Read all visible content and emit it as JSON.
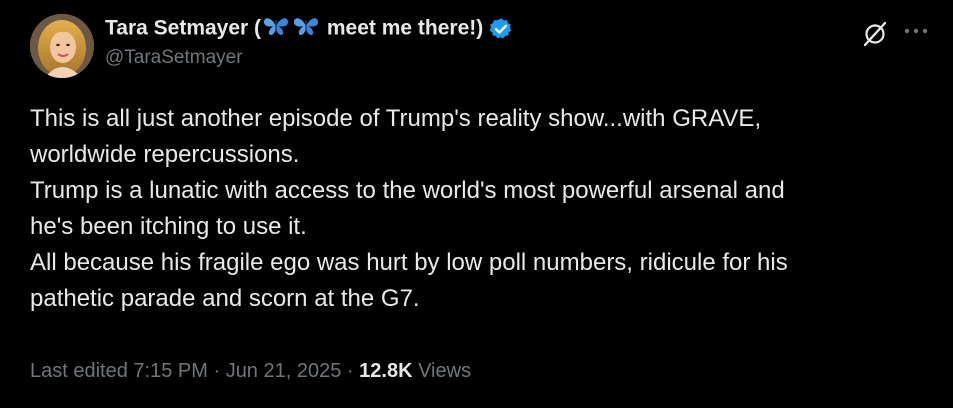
{
  "author": {
    "name_prefix": "Tara Setmayer (",
    "name_suffix": " meet me there!)",
    "handle": "@TaraSetmayer",
    "avatar_icon": "profile-photo",
    "verified_icon": "verified-badge",
    "emoji_icon": "butterfly-icon"
  },
  "actions": {
    "grok_icon": "grok-icon",
    "more_icon": "more-options-icon"
  },
  "tweet": {
    "lines": [
      "This is all just another episode of Trump's reality show...with GRAVE,",
      "worldwide repercussions.",
      "Trump is a lunatic with access to the world's most powerful arsenal and",
      "he's been itching to use it.",
      "All because his fragile ego was hurt by low poll numbers, ridicule for his",
      "pathetic parade and scorn at the G7."
    ]
  },
  "meta": {
    "edited": "Last edited 7:15 PM",
    "separator": "·",
    "date": "Jun 21, 2025",
    "views_count": "12.8K",
    "views_label": "Views"
  },
  "colors": {
    "background": "#000000",
    "text": "#e7e9ea",
    "secondary": "#71767b",
    "verified": "#1d9bf0",
    "butterfly": "#4a90e2"
  }
}
